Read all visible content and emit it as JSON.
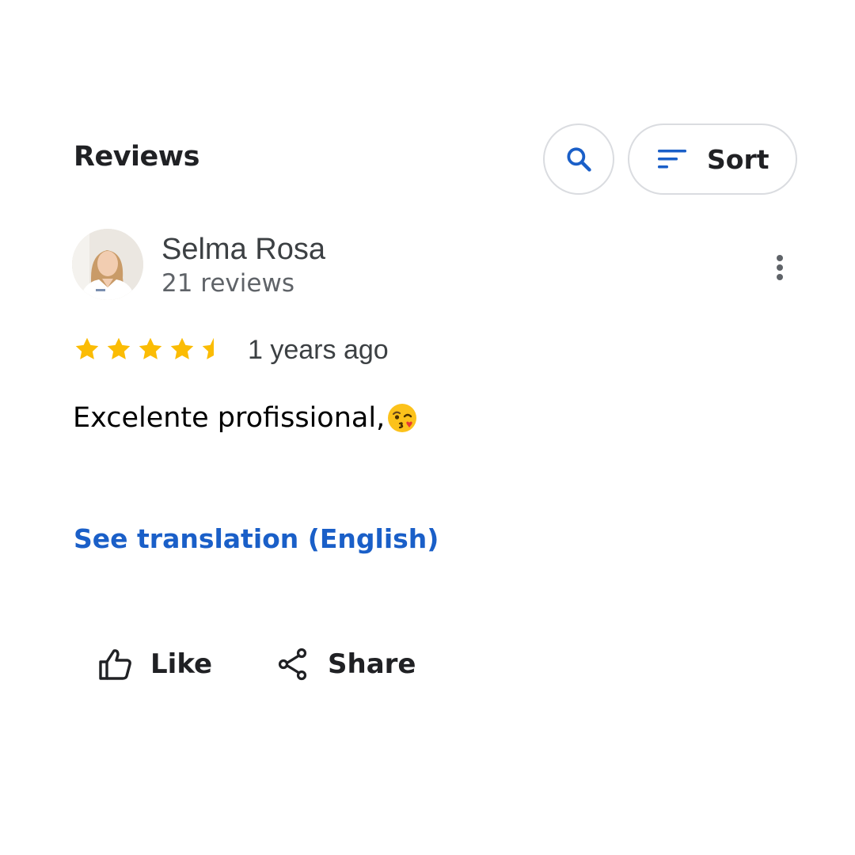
{
  "header": {
    "title": "Reviews",
    "sort_label": "Sort"
  },
  "review": {
    "author": "Selma Rosa",
    "author_review_count": "21 reviews",
    "rating": 4.5,
    "rating_max": 5,
    "time": "1 years ago",
    "text": "Excelente profissional,",
    "emoji": "face-throwing-kiss",
    "translate_link": "See translation (English)"
  },
  "actions": {
    "like_label": "Like",
    "share_label": "Share"
  },
  "colors": {
    "accent_blue": "#1a5fc8",
    "star_yellow": "#fbbc04",
    "border_gray": "#dadce0"
  }
}
